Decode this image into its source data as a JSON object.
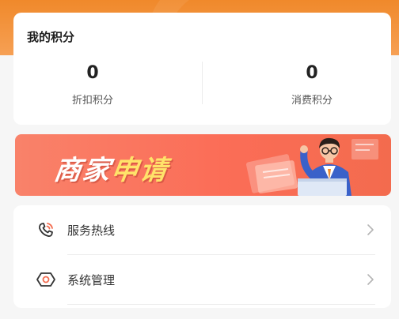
{
  "points": {
    "title": "我的积分",
    "discount": {
      "value": "0",
      "label": "折扣积分"
    },
    "consume": {
      "value": "0",
      "label": "消费积分"
    }
  },
  "banner": {
    "title_part1": "商家",
    "title_part2": "申请"
  },
  "menu": {
    "items": [
      {
        "label": "服务热线",
        "icon": "phone-icon"
      },
      {
        "label": "系统管理",
        "icon": "hexagon-settings-icon"
      }
    ]
  },
  "colors": {
    "header": "#f0892b",
    "banner": "#fb6d57",
    "banner_highlight": "#ffe36a",
    "icon_primary": "#333333",
    "icon_accent": "#f36b4e"
  }
}
